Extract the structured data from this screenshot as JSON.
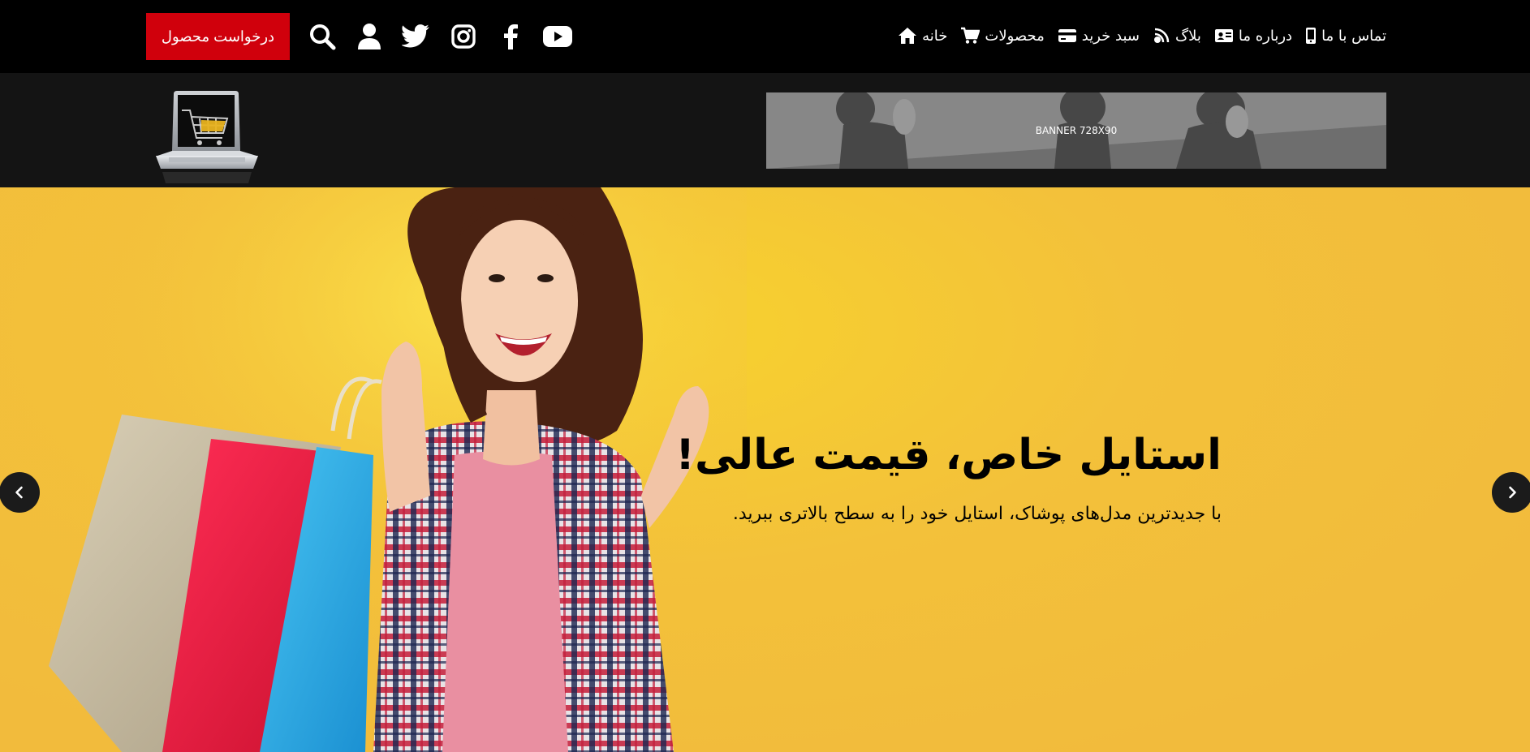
{
  "header": {
    "nav": [
      {
        "label": "خانه",
        "icon": "home-icon"
      },
      {
        "label": "محصولات",
        "icon": "cart-icon"
      },
      {
        "label": "سبد خرید",
        "icon": "credit-card-icon"
      },
      {
        "label": "بلاگ",
        "icon": "blog-icon"
      },
      {
        "label": "درباره ما",
        "icon": "id-card-icon"
      },
      {
        "label": "تماس با ما",
        "icon": "mobile-icon"
      }
    ],
    "social": [
      "youtube-icon",
      "facebook-icon",
      "instagram-icon",
      "twitter-icon"
    ],
    "request_button": "درخواست محصول"
  },
  "banner": {
    "ad_label": "BANNER 728X90",
    "accent_color": "#d0000c"
  },
  "hero": {
    "title": "استایل خاص، قیمت عالی!",
    "subtitle": "با جدیدترین مدل‌های پوشاک، استایل خود را به سطح بالاتری ببرید.",
    "background_color": "#f2bb3c"
  }
}
